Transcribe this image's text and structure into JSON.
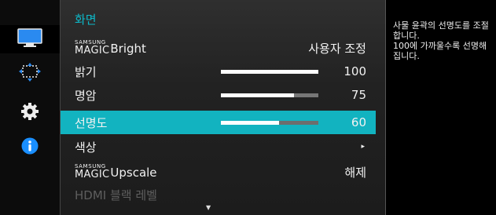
{
  "sidebar": {
    "tabs": [
      {
        "icon": "monitor-picture-icon",
        "active": true
      },
      {
        "icon": "screen-resize-icon",
        "active": false
      },
      {
        "icon": "gear-icon",
        "active": false
      },
      {
        "icon": "info-icon",
        "active": false
      }
    ]
  },
  "menu": {
    "title": "화면",
    "magic_brand": "SAMSUNG",
    "magic_word": "MAGIC",
    "items": [
      {
        "label": "Bright",
        "value": "사용자 조정"
      },
      {
        "label": "밝기",
        "value": "100",
        "level": 100
      },
      {
        "label": "명암",
        "value": "75",
        "level": 75
      },
      {
        "label": "선명도",
        "value": "60",
        "level": 60
      },
      {
        "label": "색상",
        "value": "▸"
      },
      {
        "label": "Upscale",
        "value": "해제"
      },
      {
        "label": "HDMI 블랙 레벨"
      }
    ],
    "more_indicator": "▼"
  },
  "help_text": "사물 윤곽의 선명도를 조절합니다.\n100에 가까울수록 선명해집니다.",
  "colors": {
    "accent": "#12b3c0",
    "title": "#0db8c8",
    "info_blue": "#1a8fff"
  }
}
